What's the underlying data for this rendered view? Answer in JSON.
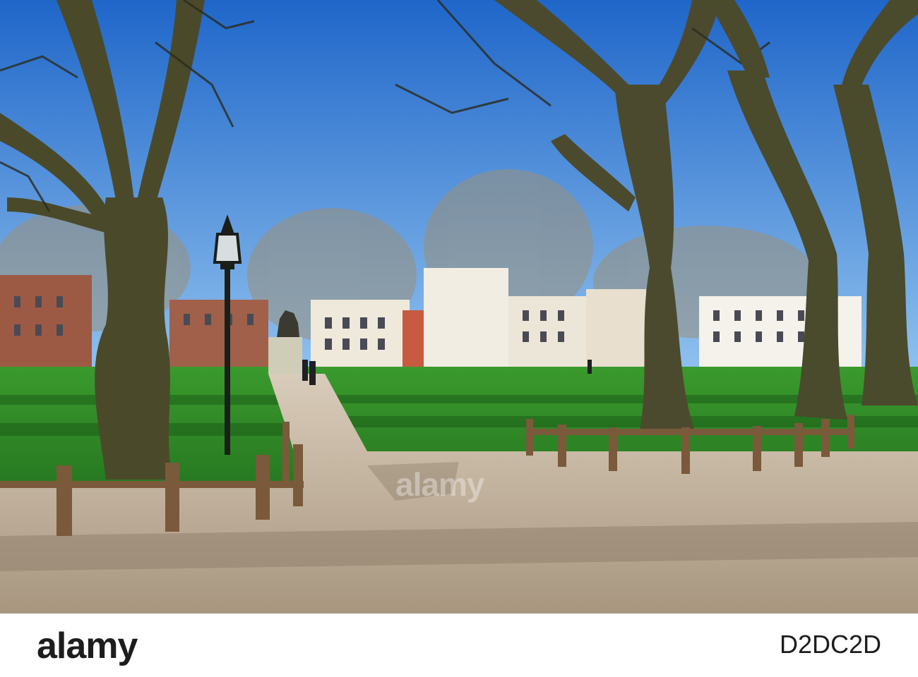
{
  "photo": {
    "subject": "park-with-bare-trees-path-and-statue",
    "colors": {
      "sky": "#3f86d6",
      "grass": "#2f8a2a",
      "path": "#c6b7a4",
      "trunk": "#4a4a2a",
      "buildings": "#efe9dc"
    }
  },
  "footer": {
    "logo": "alamy",
    "image_id": "D2DC2D"
  },
  "watermark": "alamy"
}
